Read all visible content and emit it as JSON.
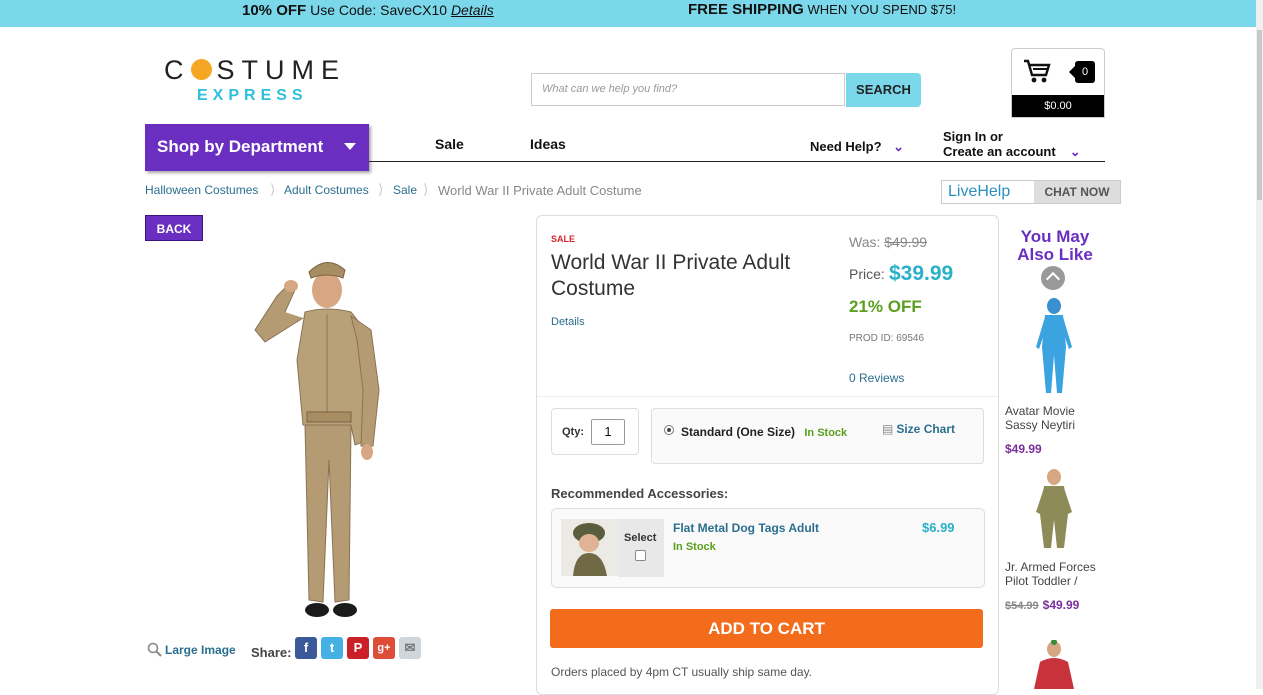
{
  "promo": {
    "discount_bold": "10% OFF",
    "discount_text": "Use Code: SaveCX10",
    "discount_link": "Details",
    "shipping_bold": "FREE SHIPPING",
    "shipping_text": "WHEN YOU SPEND $75!"
  },
  "logo": {
    "line1_pre": "C",
    "line1_post": "STUME",
    "line2": "EXPRESS"
  },
  "search": {
    "placeholder": "What can we help you find?",
    "button": "SEARCH"
  },
  "cart": {
    "count": "0",
    "total": "$0.00"
  },
  "nav": {
    "department": "Shop by Department",
    "sale": "Sale",
    "ideas": "Ideas",
    "help": "Need Help?",
    "sign_in_1": "Sign In or",
    "sign_in_2": "Create an account"
  },
  "breadcrumb": {
    "items": [
      "Halloween Costumes",
      "Adult Costumes",
      "Sale"
    ],
    "current": "World War II Private Adult Costume"
  },
  "livehelp": {
    "label": "LiveHelp",
    "chat": "CHAT NOW"
  },
  "back": "BACK",
  "media": {
    "large_image": "Large Image",
    "share": "Share:"
  },
  "product": {
    "sale_tag": "SALE",
    "title": "World War II Private Adult Costume",
    "details": "Details",
    "was_label": "Was:",
    "was_price": "$49.99",
    "price_label": "Price:",
    "price": "$39.99",
    "off": "21% OFF",
    "prod_id": "PROD ID:  69546",
    "reviews": "0 Reviews",
    "qty_label": "Qty:",
    "qty_value": "1",
    "size_label": "Standard (One Size)",
    "size_stock": "In Stock",
    "size_chart": "Size Chart"
  },
  "accessories": {
    "heading": "Recommended Accessories:",
    "select_label": "Select",
    "name": "Flat Metal Dog Tags Adult",
    "stock": "In Stock",
    "price": "$6.99"
  },
  "add_to_cart": "ADD TO CART",
  "ship_note": "Orders placed by 4pm CT usually ship same day.",
  "you_may_also_like": {
    "heading_1": "You May",
    "heading_2": "Also Like",
    "items": [
      {
        "name_1": "Avatar Movie",
        "name_2": "Sassy Neytiri",
        "old_price": "",
        "price": "$49.99"
      },
      {
        "name_1": "Jr. Armed Forces",
        "name_2": "Pilot Toddler /",
        "old_price": "$54.99",
        "price": "$49.99"
      }
    ]
  },
  "colors": {
    "promo_bar": "#7ad8ea",
    "purple": "#6a2fc0",
    "orange": "#f26c1c",
    "price_teal": "#2ab0c8",
    "green": "#5aa01e"
  },
  "icons": [
    "search-icon",
    "cart-icon",
    "chevron-down-icon",
    "facebook-icon",
    "twitter-icon",
    "pinterest-icon",
    "googleplus-icon",
    "email-icon",
    "chevron-up-icon",
    "ruler-icon"
  ]
}
